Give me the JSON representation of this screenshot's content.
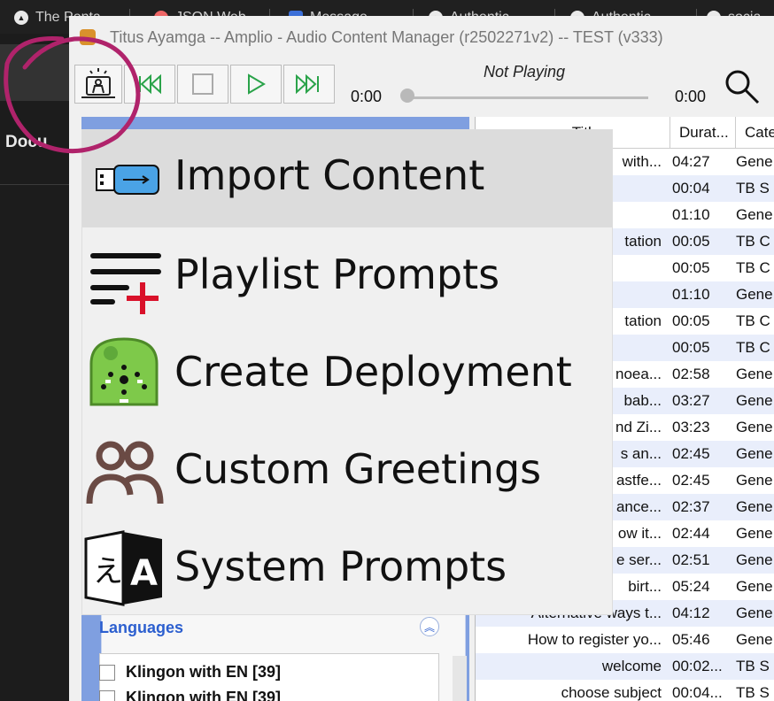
{
  "browser": {
    "tabs": [
      "The Penta",
      "JSON Web",
      "Message",
      "Authentic",
      "Authentic",
      "socia"
    ],
    "sidebar_text": "Docu"
  },
  "window": {
    "title": "Titus Ayamga  --  Amplio - Audio Content Manager (r2502271v2)  --  TEST (v333)"
  },
  "player": {
    "status": "Not Playing",
    "time_elapsed": "0:00",
    "time_total": "0:00",
    "position_fraction": 0
  },
  "menu": {
    "items": [
      {
        "label": "Import Content",
        "icon": "usb-drive-icon",
        "selected": true
      },
      {
        "label": "Playlist Prompts",
        "icon": "playlist-add-icon"
      },
      {
        "label": "Create Deployment",
        "icon": "talking-book-device-icon"
      },
      {
        "label": "Custom Greetings",
        "icon": "people-icon"
      },
      {
        "label": "System Prompts",
        "icon": "translate-icon"
      }
    ]
  },
  "left_panel": {
    "languages_header": "Languages",
    "languages": [
      "Klingon with EN [39]",
      "Klingon with EN [39]"
    ]
  },
  "table": {
    "columns": [
      "Title",
      "Durat...",
      "Cate"
    ],
    "rows": [
      {
        "title": "with...",
        "duration": "04:27",
        "category": "Gene"
      },
      {
        "title": "",
        "duration": "00:04",
        "category": "TB S"
      },
      {
        "title": "",
        "duration": "01:10",
        "category": "Gene"
      },
      {
        "title": "tation",
        "duration": "00:05",
        "category": "TB C"
      },
      {
        "title": "",
        "duration": "00:05",
        "category": "TB C"
      },
      {
        "title": "",
        "duration": "01:10",
        "category": "Gene"
      },
      {
        "title": "tation",
        "duration": "00:05",
        "category": "TB C"
      },
      {
        "title": "",
        "duration": "00:05",
        "category": "TB C"
      },
      {
        "title": "noea...",
        "duration": "02:58",
        "category": "Gene"
      },
      {
        "title": "bab...",
        "duration": "03:27",
        "category": "Gene"
      },
      {
        "title": "nd Zi...",
        "duration": "03:23",
        "category": "Gene"
      },
      {
        "title": "s an...",
        "duration": "02:45",
        "category": "Gene"
      },
      {
        "title": "astfe...",
        "duration": "02:45",
        "category": "Gene"
      },
      {
        "title": "ance...",
        "duration": "02:37",
        "category": "Gene"
      },
      {
        "title": "ow it...",
        "duration": "02:44",
        "category": "Gene"
      },
      {
        "title": "e ser...",
        "duration": "02:51",
        "category": "Gene"
      },
      {
        "title": "birt...",
        "duration": "05:24",
        "category": "Gene"
      },
      {
        "title": "Alternative ways t...",
        "duration": "04:12",
        "category": "Gene"
      },
      {
        "title": "How to register yo...",
        "duration": "05:46",
        "category": "Gene"
      },
      {
        "title": "welcome",
        "duration": "00:02...",
        "category": "TB S"
      },
      {
        "title": "choose subject",
        "duration": "00:04...",
        "category": "TB S"
      }
    ]
  },
  "colors": {
    "panel_blue": "#7f9fe0",
    "play_green": "#2aa34a",
    "annotation": "#b0236b"
  }
}
